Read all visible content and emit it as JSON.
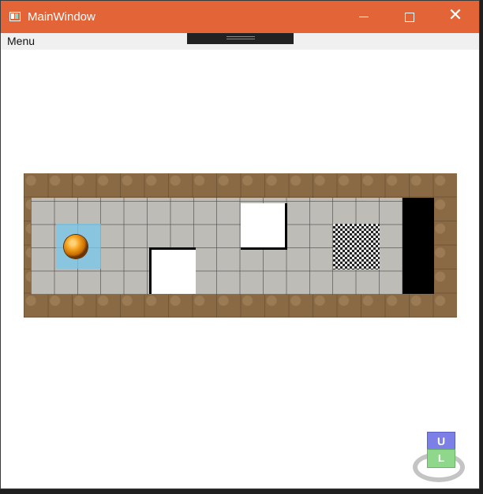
{
  "window": {
    "title": "MainWindow",
    "title_bar_color": "#e36437",
    "icon": "app-window-icon"
  },
  "controls": {
    "minimize_icon": "minimize-icon",
    "maximize_icon": "maximize-icon",
    "close_glyph": "✕"
  },
  "menu": {
    "items": [
      "Menu"
    ]
  },
  "scene": {
    "floor_color": "#bdbcb6",
    "border_color": "#8a6a45",
    "start_tile_color": "#78c8eb",
    "ball_color": "#f5a623",
    "goal_pattern": "checkerboard"
  },
  "view_cube": {
    "top_label": "U",
    "front_label": "L"
  }
}
